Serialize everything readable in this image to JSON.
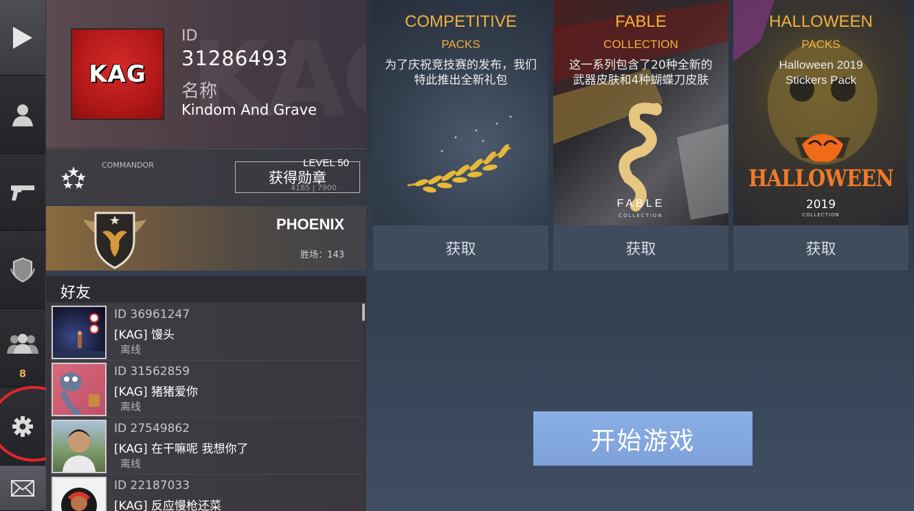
{
  "nav": {
    "friends_count": "8"
  },
  "profile": {
    "id_label": "ID",
    "id_value": "31286493",
    "name_label": "名称",
    "name_value": "Kindom And Grave",
    "avatar_text": "KAG"
  },
  "rank": {
    "title": "COMMANDOR",
    "medal_button": "获得勋章",
    "level": "LEVEL 50",
    "xp": "4185 | 7900"
  },
  "emblem": {
    "name": "PHOENIX",
    "wins": "胜场：143"
  },
  "friends": {
    "header": "好友",
    "items": [
      {
        "id": "ID 36961247",
        "name": "[KAG] 馒头",
        "status": "离线"
      },
      {
        "id": "ID 31562859",
        "name": "[KAG] 猪猪爱你",
        "status": "离线"
      },
      {
        "id": "ID 27549862",
        "name": "[KAG] 在干嘛呢 我想你了",
        "status": "离线"
      },
      {
        "id": "ID 22187033",
        "name": "[KAG] 反应慢枪还菜",
        "status": ""
      }
    ]
  },
  "packs": [
    {
      "title": "COMPETITIVE",
      "subtitle": "PACKS",
      "description_line1": "为了庆祝竞技赛的发布，我们",
      "description_line2": "特此推出全新礼包",
      "button": "获取"
    },
    {
      "title": "FABLE",
      "subtitle": "COLLECTION",
      "description_line1": "这一系列包含了20种全新的",
      "description_line2": "武器皮肤和4种蝴蝶刀皮肤",
      "art_text": "FABLE",
      "art_subtext": "COLLECTION",
      "button": "获取"
    },
    {
      "title": "HALLOWEEN",
      "subtitle": "PACKS",
      "description_line1": "Halloween 2019",
      "description_line2": "Stickers Pack",
      "art_text": "HALLOWEEN",
      "art_year": "2019",
      "art_subtext": "COLLECTION",
      "button": "获取"
    }
  ],
  "start_button": "开始游戏",
  "colors": {
    "accent_gold": "#f2b23c",
    "start_button": "#80a3da",
    "highlight_ring": "#e0262b",
    "badge": "#e8b24a"
  }
}
